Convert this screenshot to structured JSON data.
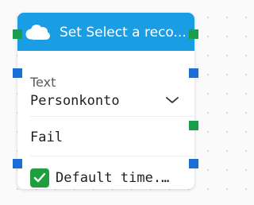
{
  "node": {
    "title": "Set Select a reco...",
    "header_color": "#1a9de3",
    "header_icon": "cloud-icon",
    "field": {
      "label": "Text",
      "value": "Personkonto",
      "icon": "chevron-down-icon"
    },
    "fail_label": "Fail",
    "checkbox": {
      "label": "Default time...",
      "checked": true,
      "color": "#1e9e3f"
    }
  },
  "ports": {
    "flow_color": "#1a9e4b",
    "data_color": "#1a6fd6"
  }
}
